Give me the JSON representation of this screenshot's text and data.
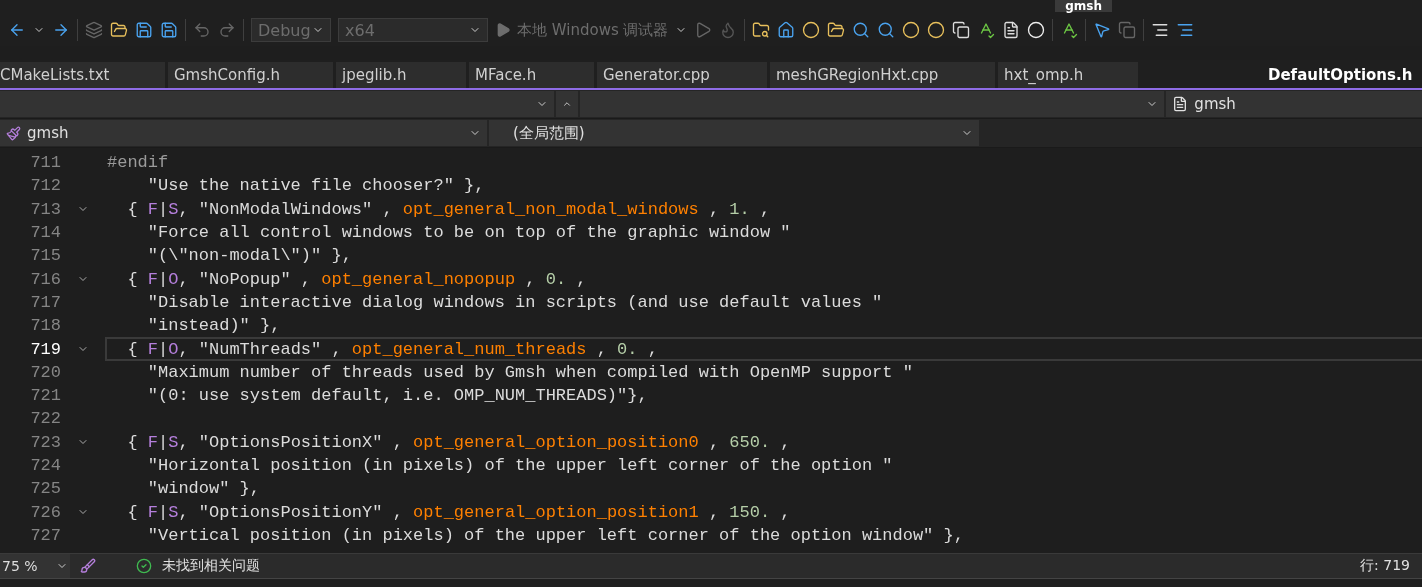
{
  "window": {
    "title": "gmsh"
  },
  "toolbar": {
    "configuration": "Debug",
    "platform": "x64",
    "run_target": "本地 Windows 调试器"
  },
  "tabs": [
    {
      "label": "CMakeLists.txt",
      "selected": false
    },
    {
      "label": "GmshConfig.h",
      "selected": false
    },
    {
      "label": "jpeglib.h",
      "selected": false
    },
    {
      "label": "MFace.h",
      "selected": false
    },
    {
      "label": "Generator.cpp",
      "selected": false
    },
    {
      "label": "meshGRegionHxt.cpp",
      "selected": false
    },
    {
      "label": "hxt_omp.h",
      "selected": false
    },
    {
      "label": "DefaultOptions.h",
      "selected": true
    }
  ],
  "navigation": {
    "file_project": "gmsh",
    "project": "gmsh",
    "scope": "(全局范围)"
  },
  "code_lines": [
    {
      "number": "711",
      "kind": "directive",
      "foldable": false,
      "current": false,
      "tokens": [
        {
          "kind": "directive",
          "text": "#endif"
        }
      ]
    },
    {
      "number": "712",
      "kind": "text",
      "foldable": false,
      "current": false,
      "tokens": [
        {
          "kind": "string",
          "text": "\"Use the native file chooser?\""
        },
        {
          "kind": "plain",
          "text": " },"
        }
      ]
    },
    {
      "number": "713",
      "kind": "entry",
      "foldable": true,
      "current": false,
      "tokens": [
        {
          "kind": "plain",
          "text": "{ "
        },
        {
          "kind": "macro",
          "text": "F"
        },
        {
          "kind": "plain",
          "text": "|"
        },
        {
          "kind": "macro",
          "text": "S"
        },
        {
          "kind": "plain",
          "text": ", "
        },
        {
          "kind": "string",
          "text": "\"NonModalWindows\""
        },
        {
          "kind": "plain",
          "text": " , "
        },
        {
          "kind": "identifier",
          "text": "opt_general_non_modal_windows"
        },
        {
          "kind": "plain",
          "text": " , "
        },
        {
          "kind": "number",
          "text": "1."
        },
        {
          "kind": "plain",
          "text": " ,"
        }
      ]
    },
    {
      "number": "714",
      "kind": "text",
      "foldable": false,
      "current": false,
      "tokens": [
        {
          "kind": "string",
          "text": "\"Force all control windows to be on top of the graphic window \""
        }
      ]
    },
    {
      "number": "715",
      "kind": "text",
      "foldable": false,
      "current": false,
      "tokens": [
        {
          "kind": "string",
          "text": "\"(\\\"non-modal\\\")\""
        },
        {
          "kind": "plain",
          "text": " },"
        }
      ]
    },
    {
      "number": "716",
      "kind": "entry",
      "foldable": true,
      "current": false,
      "tokens": [
        {
          "kind": "plain",
          "text": "{ "
        },
        {
          "kind": "macro",
          "text": "F"
        },
        {
          "kind": "plain",
          "text": "|"
        },
        {
          "kind": "macro",
          "text": "O"
        },
        {
          "kind": "plain",
          "text": ", "
        },
        {
          "kind": "string",
          "text": "\"NoPopup\""
        },
        {
          "kind": "plain",
          "text": " , "
        },
        {
          "kind": "identifier",
          "text": "opt_general_nopopup"
        },
        {
          "kind": "plain",
          "text": " , "
        },
        {
          "kind": "number",
          "text": "0."
        },
        {
          "kind": "plain",
          "text": " ,"
        }
      ]
    },
    {
      "number": "717",
      "kind": "text",
      "foldable": false,
      "current": false,
      "tokens": [
        {
          "kind": "string",
          "text": "\"Disable interactive dialog windows in scripts (and use default values \""
        }
      ]
    },
    {
      "number": "718",
      "kind": "text",
      "foldable": false,
      "current": false,
      "tokens": [
        {
          "kind": "string",
          "text": "\"instead)\""
        },
        {
          "kind": "plain",
          "text": " },"
        }
      ]
    },
    {
      "number": "719",
      "kind": "entry",
      "foldable": true,
      "current": true,
      "tokens": [
        {
          "kind": "plain",
          "text": "{ "
        },
        {
          "kind": "macro",
          "text": "F"
        },
        {
          "kind": "plain",
          "text": "|"
        },
        {
          "kind": "macro",
          "text": "O"
        },
        {
          "kind": "plain",
          "text": ", "
        },
        {
          "kind": "string",
          "text": "\"NumThreads\""
        },
        {
          "kind": "plain",
          "text": " , "
        },
        {
          "kind": "identifier",
          "text": "opt_general_num_threads"
        },
        {
          "kind": "plain",
          "text": " , "
        },
        {
          "kind": "number",
          "text": "0."
        },
        {
          "kind": "plain",
          "text": " ,"
        }
      ]
    },
    {
      "number": "720",
      "kind": "text",
      "foldable": false,
      "current": false,
      "tokens": [
        {
          "kind": "string",
          "text": "\"Maximum number of threads used by Gmsh when compiled with OpenMP support \""
        }
      ]
    },
    {
      "number": "721",
      "kind": "text",
      "foldable": false,
      "current": false,
      "tokens": [
        {
          "kind": "string",
          "text": "\"(0: use system default, i.e. OMP_NUM_THREADS)\""
        },
        {
          "kind": "plain",
          "text": "},"
        }
      ]
    },
    {
      "number": "722",
      "kind": "blank",
      "foldable": false,
      "current": false
    },
    {
      "number": "723",
      "kind": "entry",
      "foldable": true,
      "current": false,
      "tokens": [
        {
          "kind": "plain",
          "text": "{ "
        },
        {
          "kind": "macro",
          "text": "F"
        },
        {
          "kind": "plain",
          "text": "|"
        },
        {
          "kind": "macro",
          "text": "S"
        },
        {
          "kind": "plain",
          "text": ", "
        },
        {
          "kind": "string",
          "text": "\"OptionsPositionX\""
        },
        {
          "kind": "plain",
          "text": " , "
        },
        {
          "kind": "identifier",
          "text": "opt_general_option_position0"
        },
        {
          "kind": "plain",
          "text": " , "
        },
        {
          "kind": "number",
          "text": "650."
        },
        {
          "kind": "plain",
          "text": " ,"
        }
      ]
    },
    {
      "number": "724",
      "kind": "text",
      "foldable": false,
      "current": false,
      "tokens": [
        {
          "kind": "string",
          "text": "\"Horizontal position (in pixels) of the upper left corner of the option \""
        }
      ]
    },
    {
      "number": "725",
      "kind": "text",
      "foldable": false,
      "current": false,
      "tokens": [
        {
          "kind": "string",
          "text": "\"window\""
        },
        {
          "kind": "plain",
          "text": " },"
        }
      ]
    },
    {
      "number": "726",
      "kind": "entry",
      "foldable": true,
      "current": false,
      "tokens": [
        {
          "kind": "plain",
          "text": "{ "
        },
        {
          "kind": "macro",
          "text": "F"
        },
        {
          "kind": "plain",
          "text": "|"
        },
        {
          "kind": "macro",
          "text": "S"
        },
        {
          "kind": "plain",
          "text": ", "
        },
        {
          "kind": "string",
          "text": "\"OptionsPositionY\""
        },
        {
          "kind": "plain",
          "text": " , "
        },
        {
          "kind": "identifier",
          "text": "opt_general_option_position1"
        },
        {
          "kind": "plain",
          "text": " , "
        },
        {
          "kind": "number",
          "text": "150."
        },
        {
          "kind": "plain",
          "text": " ,"
        }
      ]
    },
    {
      "number": "727",
      "kind": "text",
      "foldable": false,
      "current": false,
      "tokens": [
        {
          "kind": "string",
          "text": "\"Vertical position (in pixels) of the upper left corner of the option window\""
        },
        {
          "kind": "plain",
          "text": " },"
        }
      ]
    }
  ],
  "status_bar": {
    "zoom": "75 %",
    "issues": "未找到相关问题",
    "position": "行: 719"
  }
}
